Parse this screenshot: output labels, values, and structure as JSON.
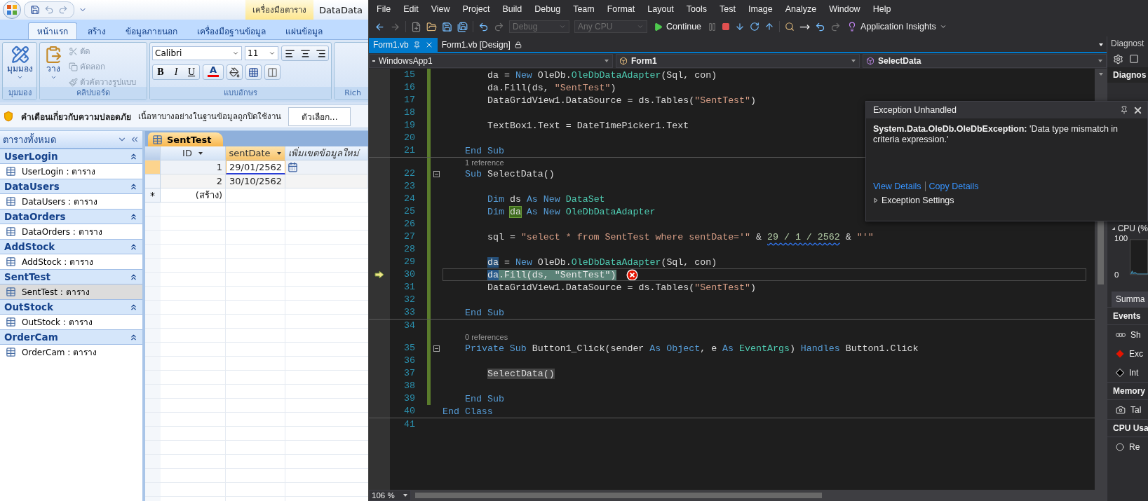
{
  "access": {
    "contextual_tab": "เครื่องมือตาราง",
    "title": "DataData",
    "ribbon_tabs": [
      {
        "label": "หน้าแรก",
        "selected": true
      },
      {
        "label": "สร้าง",
        "selected": false
      },
      {
        "label": "ข้อมูลภายนอก",
        "selected": false
      },
      {
        "label": "เครื่องมือฐานข้อมูล",
        "selected": false
      },
      {
        "label": "แผ่นข้อมูล",
        "selected": false
      }
    ],
    "views_group": {
      "button": "มุมมอง",
      "label": "มุมมอง"
    },
    "clipboard_group": {
      "paste": "วาง",
      "commands": [
        {
          "kind": "cut",
          "label": "ตัด",
          "disabled": true
        },
        {
          "kind": "copy",
          "label": "คัดลอก",
          "disabled": true
        },
        {
          "kind": "format-painter",
          "label": "ตัวคัดวางรูปแบบ",
          "disabled": true
        }
      ],
      "label": "คลิปบอร์ด"
    },
    "font_group": {
      "font": "Calibri",
      "size": "11",
      "styles": [
        "B",
        "I",
        "U"
      ],
      "font_color": "A",
      "label": "แบบอักษร"
    },
    "rich_group": {
      "label": "Rich"
    },
    "security_bar": {
      "title": "คำเตือนเกี่ยวกับความปลอดภัย",
      "message": "เนื้อหาบางอย่างในฐานข้อมูลถูกปิดใช้งาน",
      "button": "ตัวเลือก..."
    },
    "nav_pane": {
      "title": "ตารางทั้งหมด",
      "groups": [
        {
          "name": "UserLogin",
          "item": "UserLogin : ตาราง",
          "selected": false
        },
        {
          "name": "DataUsers",
          "item": "DataUsers : ตาราง",
          "selected": false
        },
        {
          "name": "DataOrders",
          "item": "DataOrders : ตาราง",
          "selected": false
        },
        {
          "name": "AddStock",
          "item": "AddStock : ตาราง",
          "selected": false
        },
        {
          "name": "SentTest",
          "item": "SentTest : ตาราง",
          "selected": true
        },
        {
          "name": "OutStock",
          "item": "OutStock : ตาราง",
          "selected": false
        },
        {
          "name": "OrderCam",
          "item": "OrderCam : ตาราง",
          "selected": false
        }
      ]
    },
    "datasheet": {
      "tab": "SentTest",
      "columns": [
        {
          "kind": "field",
          "label": "ID",
          "selected": false
        },
        {
          "kind": "field",
          "label": "sentDate",
          "selected": true
        },
        {
          "kind": "add-field",
          "label": "เพิ่มเขตข้อมูลใหม่",
          "selected": false
        }
      ],
      "rows": [
        {
          "id": "1",
          "sent_date": "29/01/2562",
          "selected": true
        },
        {
          "id": "2",
          "sent_date": "30/10/2562",
          "selected": false
        }
      ],
      "new_row": {
        "marker": "*",
        "id": "(สร้าง)"
      }
    }
  },
  "vs": {
    "menu": [
      "File",
      "Edit",
      "View",
      "Project",
      "Build",
      "Debug",
      "Team",
      "Format",
      "Layout",
      "Tools",
      "Test",
      "Image",
      "Analyze",
      "Window",
      "Help"
    ],
    "toolbar": {
      "configuration": {
        "value": "Debug",
        "disabled": true
      },
      "platform": {
        "value": "Any CPU",
        "disabled": true
      },
      "continue": "Continue",
      "insights": "Application Insights"
    },
    "doc_tabs": [
      {
        "label": "Form1.vb",
        "selected": true
      },
      {
        "label": "Form1.vb [Design]",
        "selected": false
      }
    ],
    "nav_bar": {
      "project": "WindowsApp1",
      "type": "Form1",
      "member": "SelectData"
    },
    "code_lines": [
      {
        "kind": "body",
        "number": "15",
        "modified": true,
        "tokens": [
          {
            "kind": "plain",
            "text": "da = "
          },
          {
            "kind": "keyword",
            "text": "New"
          },
          {
            "kind": "plain",
            "text": " OleDb."
          },
          {
            "kind": "type",
            "text": "OleDbDataAdapter"
          },
          {
            "kind": "plain",
            "text": "(Sql, con)"
          }
        ]
      },
      {
        "kind": "body",
        "number": "16",
        "modified": true,
        "tokens": [
          {
            "kind": "plain",
            "text": "da.Fill(ds, "
          },
          {
            "kind": "string",
            "text": "\"SentTest\""
          },
          {
            "kind": "plain",
            "text": ")"
          }
        ]
      },
      {
        "kind": "body",
        "number": "17",
        "modified": true,
        "tokens": [
          {
            "kind": "plain",
            "text": "DataGridView1.DataSource = ds.Tables("
          },
          {
            "kind": "string",
            "text": "\"SentTest\""
          },
          {
            "kind": "plain",
            "text": ")"
          }
        ]
      },
      {
        "kind": "code",
        "number": "18",
        "modified": true
      },
      {
        "kind": "body",
        "number": "19",
        "modified": true,
        "tokens": [
          {
            "kind": "plain",
            "text": "TextBox1.Text = DateTimePicker1.Text"
          }
        ]
      },
      {
        "kind": "code",
        "number": "20",
        "modified": true
      },
      {
        "kind": "member",
        "number": "21",
        "modified": true,
        "rule": true,
        "tokens": [
          {
            "kind": "keyword",
            "text": "End Sub"
          }
        ]
      },
      {
        "kind": "codelens",
        "text": "1 reference",
        "modified": true
      },
      {
        "kind": "member",
        "number": "22",
        "modified": true,
        "fold": true,
        "tokens": [
          {
            "kind": "keyword",
            "text": "Sub"
          },
          {
            "kind": "plain",
            "text": " SelectData()"
          }
        ]
      },
      {
        "kind": "code",
        "number": "23",
        "modified": true
      },
      {
        "kind": "body",
        "number": "24",
        "modified": true,
        "tokens": [
          {
            "kind": "keyword",
            "text": "Dim"
          },
          {
            "kind": "plain",
            "text": " ds "
          },
          {
            "kind": "keyword",
            "text": "As New "
          },
          {
            "kind": "type",
            "text": "DataSet"
          }
        ]
      },
      {
        "kind": "body",
        "number": "25",
        "modified": true,
        "tokens": [
          {
            "kind": "keyword",
            "text": "Dim "
          },
          {
            "kind": "definition",
            "text": "da"
          },
          {
            "kind": "keyword",
            "text": " As New "
          },
          {
            "kind": "type",
            "text": "OleDbDataAdapter"
          }
        ]
      },
      {
        "kind": "code",
        "number": "26",
        "modified": true
      },
      {
        "kind": "body",
        "number": "27",
        "modified": true,
        "tokens": [
          {
            "kind": "plain",
            "text": "sql = "
          },
          {
            "kind": "string",
            "text": "\"select * from SentTest where sentDate='\""
          },
          {
            "kind": "plain",
            "text": " & "
          },
          {
            "kind": "squiggle",
            "text": "29 / 1 / 2562"
          },
          {
            "kind": "plain",
            "text": " & "
          },
          {
            "kind": "string",
            "text": "\"'\""
          }
        ]
      },
      {
        "kind": "code",
        "number": "28",
        "modified": true
      },
      {
        "kind": "body",
        "number": "29",
        "modified": true,
        "tokens": [
          {
            "kind": "reference",
            "text": "da"
          },
          {
            "kind": "plain",
            "text": " = "
          },
          {
            "kind": "keyword",
            "text": "New"
          },
          {
            "kind": "plain",
            "text": " OleDb."
          },
          {
            "kind": "type",
            "text": "OleDbDataAdapter"
          },
          {
            "kind": "plain",
            "text": "(Sql, con)"
          }
        ]
      },
      {
        "kind": "body",
        "number": "30",
        "modified": true,
        "current": true,
        "error": true,
        "tokens": [
          {
            "kind": "statement_ref",
            "text": "da"
          },
          {
            "kind": "statement",
            "text": ".Fill(ds, \"SentTest\")"
          }
        ]
      },
      {
        "kind": "body",
        "number": "31",
        "modified": true,
        "tokens": [
          {
            "kind": "plain",
            "text": "DataGridView1.DataSource = ds.Tables("
          },
          {
            "kind": "string",
            "text": "\"SentTest\""
          },
          {
            "kind": "plain",
            "text": ")"
          }
        ]
      },
      {
        "kind": "code",
        "number": "32",
        "modified": true
      },
      {
        "kind": "member",
        "number": "33",
        "modified": true,
        "rule": true,
        "tokens": [
          {
            "kind": "keyword",
            "text": "End Sub"
          }
        ]
      },
      {
        "kind": "code",
        "number": "34",
        "modified": true
      },
      {
        "kind": "codelens",
        "text": "0 references",
        "modified": true
      },
      {
        "kind": "member",
        "number": "35",
        "modified": true,
        "fold": true,
        "tokens": [
          {
            "kind": "keyword",
            "text": "Private Sub"
          },
          {
            "kind": "plain",
            "text": " Button1_Click(sender "
          },
          {
            "kind": "keyword",
            "text": "As Object"
          },
          {
            "kind": "plain",
            "text": ", e "
          },
          {
            "kind": "keyword",
            "text": "As "
          },
          {
            "kind": "type",
            "text": "EventArgs"
          },
          {
            "kind": "plain",
            "text": ") "
          },
          {
            "kind": "keyword",
            "text": "Handles"
          },
          {
            "kind": "plain",
            "text": " Button1.Click"
          }
        ]
      },
      {
        "kind": "code",
        "number": "36",
        "modified": true
      },
      {
        "kind": "body",
        "number": "37",
        "modified": true,
        "tokens": [
          {
            "kind": "highlight",
            "text": "SelectData()"
          }
        ]
      },
      {
        "kind": "code",
        "number": "38",
        "modified": true
      },
      {
        "kind": "member",
        "number": "39",
        "modified": true,
        "tokens": [
          {
            "kind": "keyword",
            "text": "End Sub"
          }
        ]
      },
      {
        "kind": "class",
        "number": "40",
        "modified": false,
        "rule": true,
        "tokens": [
          {
            "kind": "keyword",
            "text": "End Class"
          }
        ]
      },
      {
        "kind": "code",
        "number": "41",
        "modified": false
      }
    ],
    "zoom": "106 %",
    "exception": {
      "title": "Exception Unhandled",
      "message": "**System.Data.OleDb.OleDbException:** 'Data type mismatch in criteria expression.'",
      "links": [
        "View Details",
        "Copy Details"
      ],
      "settings": "Exception Settings"
    },
    "diagnostics": {
      "title": "Diagnost",
      "section": "Diagnos",
      "cpu_label": "CPU (%",
      "cpu_axis": [
        "100",
        "0"
      ],
      "tab": "Summa",
      "groups": [
        {
          "header": "Events",
          "items": [
            {
              "kind": "events",
              "label": "Sh"
            },
            {
              "kind": "exception",
              "label": "Exc"
            },
            {
              "kind": "intellitrace",
              "label": "Int"
            }
          ]
        },
        {
          "header": "Memory",
          "items": [
            {
              "kind": "snapshot",
              "label": "Tal"
            }
          ]
        },
        {
          "header": "CPU Usa",
          "items": [
            {
              "kind": "record",
              "label": "Re"
            }
          ]
        }
      ]
    }
  }
}
